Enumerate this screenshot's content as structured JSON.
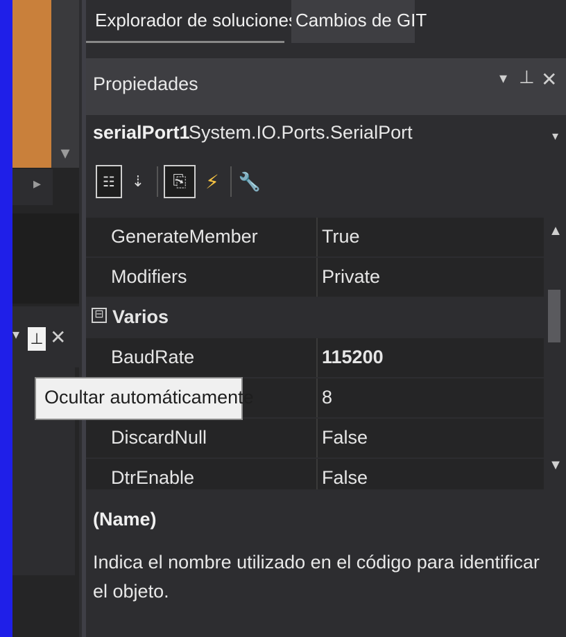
{
  "tabs": [
    {
      "label": "Explorador de soluciones"
    },
    {
      "label": "Cambios de GIT"
    }
  ],
  "properties_panel": {
    "title": "Propiedades",
    "object_name": "serialPort1",
    "object_type": "System.IO.Ports.SerialPort",
    "toolbar": {
      "categorized_icon": "categorized-icon",
      "alphabetical_icon": "alphabetical-sort-icon",
      "properties_icon": "properties-icon",
      "events_icon": "events-lightning-icon",
      "property_pages_icon": "wrench-icon"
    },
    "rows": [
      {
        "name": "GenerateMember",
        "value": "True"
      },
      {
        "name": "Modifiers",
        "value": "Private"
      },
      {
        "name": "Varios",
        "category": true,
        "toggle": "⊟"
      },
      {
        "name": "BaudRate",
        "value": "115200"
      },
      {
        "name": "",
        "value": "8"
      },
      {
        "name": "DiscardNull",
        "value": "False"
      },
      {
        "name": "DtrEnable",
        "value": "False"
      }
    ],
    "description": {
      "title": "(Name)",
      "text": "Indica el nombre utilizado en el código para identificar el objeto."
    }
  },
  "tooltip": {
    "text": "Ocultar automáticamente"
  },
  "colors": {
    "background_frame": "#1f1fe8",
    "panel_bg": "#2d2d30",
    "grid_bg": "#252526",
    "accent_orange": "#c9803b"
  }
}
